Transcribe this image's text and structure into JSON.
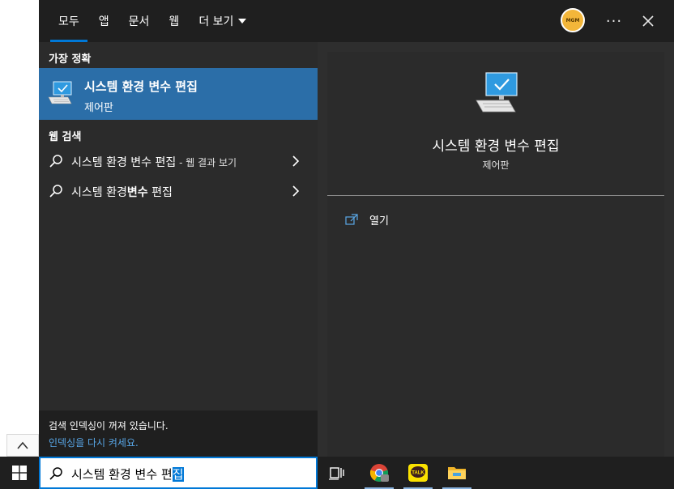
{
  "tabs": [
    {
      "label": "모두"
    },
    {
      "label": "앱"
    },
    {
      "label": "문서"
    },
    {
      "label": "웹"
    },
    {
      "label": "더 보기"
    }
  ],
  "avatar": {
    "text": "MGM"
  },
  "more_button": "···",
  "best_match": {
    "heading": "가장 정확",
    "title": "시스템 환경 변수 편집",
    "subtitle": "제어판"
  },
  "web_search": {
    "heading": "웹 검색",
    "items": [
      {
        "query": "시스템 환경 변수 편집",
        "suffix": " - 웹 결과 보기"
      },
      {
        "prefix": "시스템 환경",
        "bold": "변수",
        "rest": " 편집"
      }
    ]
  },
  "indexing": {
    "message": "검색 인덱싱이 꺼져 있습니다.",
    "link": "인덱싱을 다시 켜세요."
  },
  "preview": {
    "title": "시스템 환경 변수 편집",
    "subtitle": "제어판",
    "open_label": "열기"
  },
  "search": {
    "text_before": "시스템 환경 변수 편",
    "text_selected": "집"
  },
  "taskbar": {
    "kakao_label": "TALK"
  },
  "colors": {
    "accent": "#0078d7",
    "selected_row": "#2b6ea8",
    "panel": "#2b2b2b",
    "header": "#1f1f1f",
    "link": "#58a6e6"
  }
}
